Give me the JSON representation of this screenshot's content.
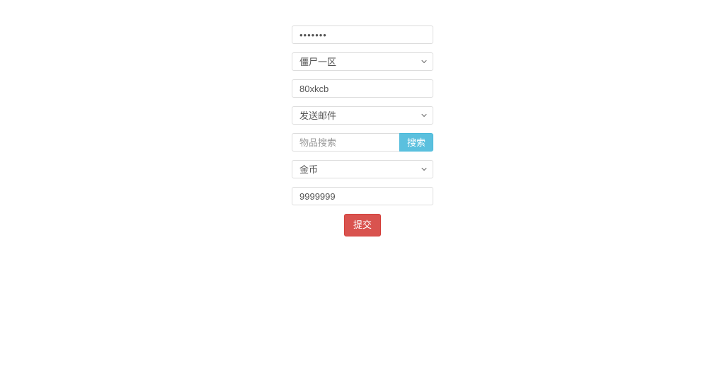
{
  "form": {
    "password": {
      "value": "1234567"
    },
    "zone_select": {
      "selected": "僵尸一区"
    },
    "account_input": {
      "value": "80xkcb"
    },
    "action_select": {
      "selected": "发送邮件"
    },
    "item_search": {
      "placeholder": "物品搜索",
      "value": "",
      "button_label": "搜索"
    },
    "item_select": {
      "selected": "金币"
    },
    "amount_input": {
      "value": "9999999"
    },
    "submit_label": "提交"
  }
}
